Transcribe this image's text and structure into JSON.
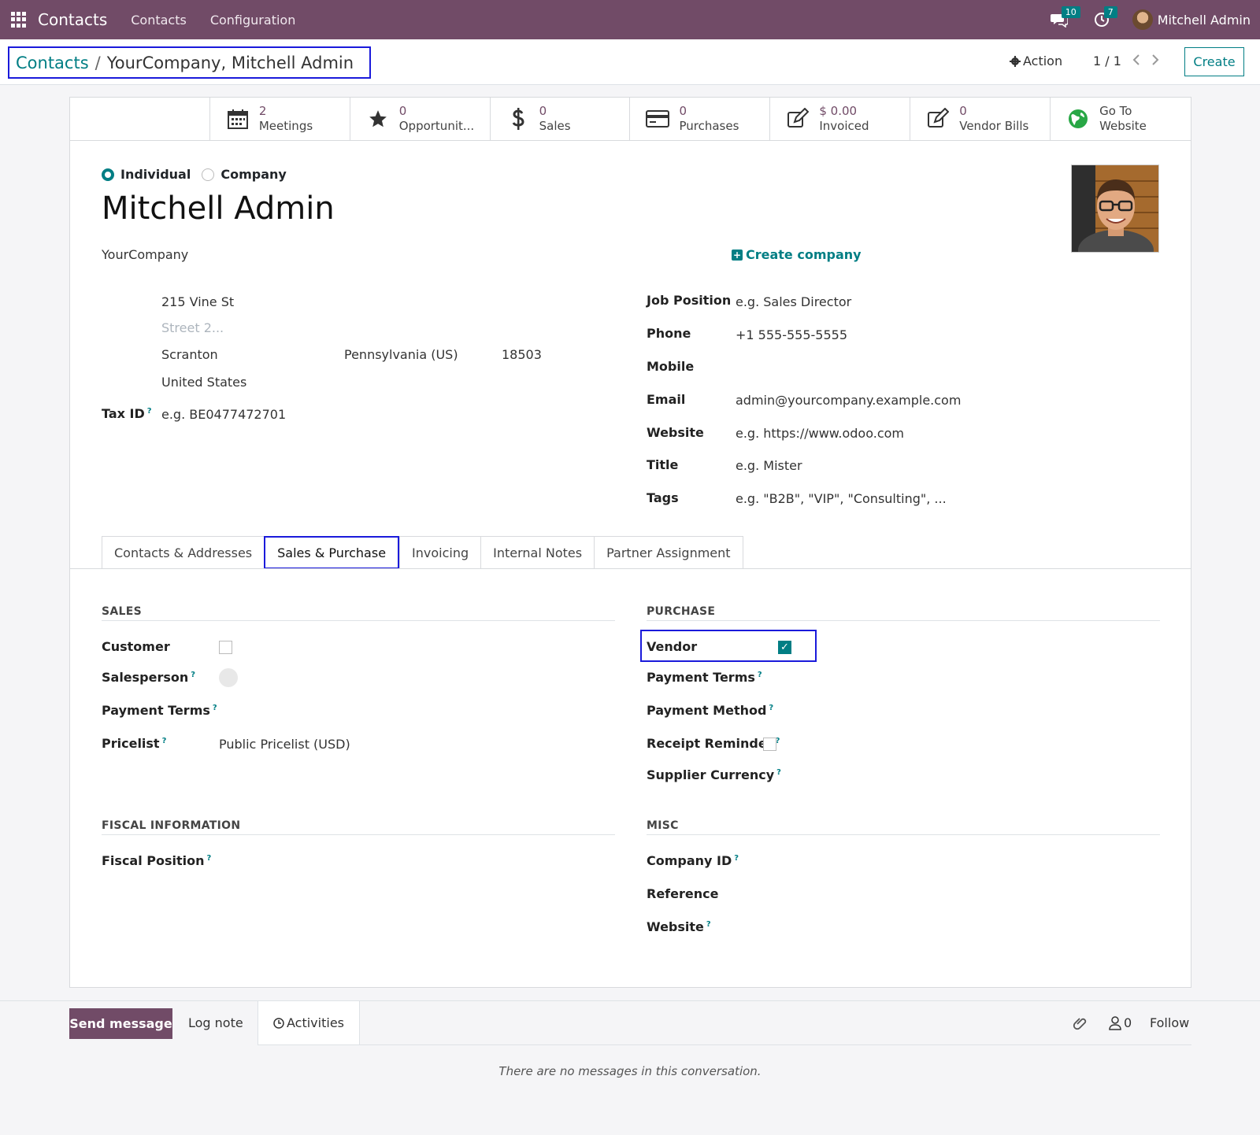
{
  "navbar": {
    "app_name": "Contacts",
    "menus": [
      "Contacts",
      "Configuration"
    ],
    "messages_count": "10",
    "activities_count": "7",
    "user_name": "Mitchell Admin",
    "color": "#714b67"
  },
  "control_panel": {
    "breadcrumb_parent": "Contacts",
    "breadcrumb_separator": "/",
    "breadcrumb_current": "YourCompany, Mitchell Admin",
    "action_label": "Action",
    "pager": "1 / 1",
    "create_label": "Create"
  },
  "stat_buttons": [
    {
      "value": "2",
      "label": "Meetings",
      "icon": "calendar-icon"
    },
    {
      "value": "0",
      "label": "Opportunit...",
      "icon": "star-icon"
    },
    {
      "value": "0",
      "label": "Sales",
      "icon": "dollar-icon"
    },
    {
      "value": "0",
      "label": "Purchases",
      "icon": "credit-card-icon"
    },
    {
      "value": "$ 0.00",
      "label": "Invoiced",
      "icon": "pencil-square-icon"
    },
    {
      "value": "0",
      "label": "Vendor Bills",
      "icon": "pencil-square-icon"
    },
    {
      "value": "Go To",
      "label": "Website",
      "icon": "globe-icon"
    }
  ],
  "form": {
    "type_individual": "Individual",
    "type_company": "Company",
    "name": "Mitchell Admin",
    "company": "YourCompany",
    "create_company": "Create company",
    "street": "215 Vine St",
    "street2_placeholder": "Street 2...",
    "city": "Scranton",
    "state": "Pennsylvania (US)",
    "zip": "18503",
    "country": "United States",
    "tax_id_label": "Tax ID",
    "tax_id_placeholder": "e.g. BE0477472701",
    "job_position_label": "Job Position",
    "job_position_placeholder": "e.g. Sales Director",
    "phone_label": "Phone",
    "phone": "+1 555-555-5555",
    "mobile_label": "Mobile",
    "email_label": "Email",
    "email": "admin@yourcompany.example.com",
    "website_label": "Website",
    "website_placeholder": "e.g. https://www.odoo.com",
    "title_label": "Title",
    "title_placeholder": "e.g. Mister",
    "tags_label": "Tags",
    "tags_placeholder": "e.g. \"B2B\", \"VIP\", \"Consulting\", ..."
  },
  "tabs": [
    "Contacts & Addresses",
    "Sales & Purchase",
    "Invoicing",
    "Internal Notes",
    "Partner Assignment"
  ],
  "sales_purchase": {
    "sales_title": "SALES",
    "customer_label": "Customer",
    "salesperson_label": "Salesperson",
    "payment_terms_label": "Payment Terms",
    "pricelist_label": "Pricelist",
    "pricelist": "Public Pricelist (USD)",
    "purchase_title": "PURCHASE",
    "vendor_label": "Vendor",
    "p_payment_terms_label": "Payment Terms",
    "payment_method_label": "Payment Method",
    "receipt_reminder_label": "Receipt Reminder",
    "supplier_currency_label": "Supplier Currency",
    "fiscal_title": "FISCAL INFORMATION",
    "fiscal_position_label": "Fiscal Position",
    "misc_title": "MISC",
    "company_id_label": "Company ID",
    "reference_label": "Reference",
    "misc_website_label": "Website",
    "help_mark": "?"
  },
  "chatter": {
    "send_message": "Send message",
    "log_note": "Log note",
    "activities": "Activities",
    "followers_count": "0",
    "follow": "Follow",
    "no_messages": "There are no messages in this conversation."
  }
}
